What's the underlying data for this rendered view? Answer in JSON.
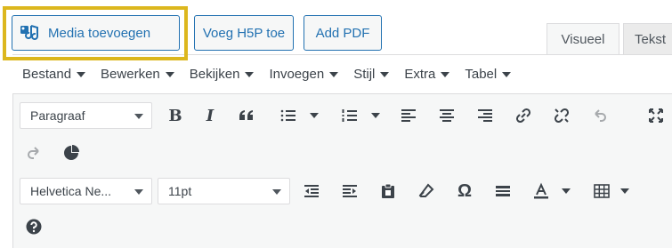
{
  "media_buttons": {
    "add_media": "Media toevoegen",
    "add_h5p": "Voeg H5P toe",
    "add_pdf": "Add PDF"
  },
  "tabs": {
    "visual": "Visueel",
    "text": "Tekst"
  },
  "menubar": [
    "Bestand",
    "Bewerken",
    "Bekijken",
    "Invoegen",
    "Stijl",
    "Extra",
    "Tabel"
  ],
  "toolbar": {
    "format_select": "Paragraaf",
    "font_family_select": "Helvetica Ne...",
    "font_size_select": "11pt"
  },
  "colors": {
    "accent": "#2271b1",
    "highlight": "#dcb71e",
    "icon": "#3c434a",
    "icon_disabled": "#a7aaad"
  }
}
